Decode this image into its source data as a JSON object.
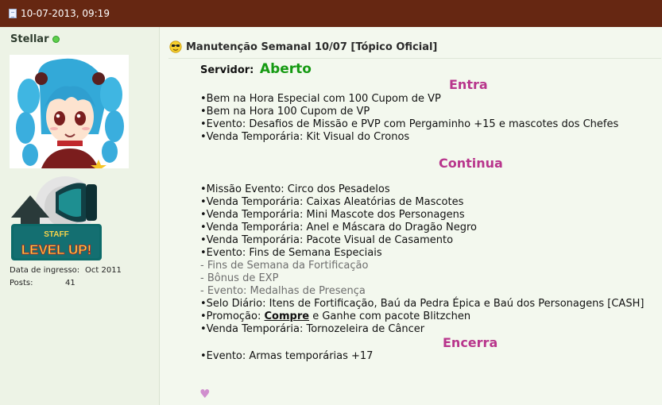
{
  "header": {
    "date": "10-07-2013, 09:19"
  },
  "user": {
    "name": "Stellar",
    "join_label": "Data de ingresso:",
    "join_value": "Oct 2011",
    "posts_label": "Posts:",
    "posts_value": "41",
    "badge_top": "STAFF",
    "badge_bottom": "LEVEL UP!"
  },
  "post": {
    "title": "Manutenção Semanal 10/07 [Tópico Oficial]",
    "server_label": "Servidor:",
    "server_status": "Aberto",
    "sections": {
      "entra": "Entra",
      "continua": "Continua",
      "encerra": "Encerra"
    },
    "entra_items": [
      "•Bem na Hora Especial com 100 Cupom de VP",
      "•Bem na Hora 100 Cupom de VP",
      "•Evento: Desafios de Missão e PVP com Pergaminho +15 e mascotes dos Chefes",
      "•Venda Temporária: Kit Visual do Cronos"
    ],
    "continua_items": [
      "•Missão Evento: Circo dos Pesadelos",
      "•Venda Temporária: Caixas Aleatórias de Mascotes",
      "•Venda Temporária: Mini Mascote dos Personagens",
      "•Venda Temporária: Anel e Máscara do Dragão Negro",
      "•Venda Temporária: Pacote Visual de Casamento",
      "•Evento: Fins de Semana Especiais"
    ],
    "sub_items": [
      " - Fins de Semana da Fortificação",
      " - Bônus de EXP",
      " - Evento: Medalhas de Presença"
    ],
    "continua_items_2": [
      "•Selo Diário: Itens de Fortificação, Baú da Pedra Épica e Baú dos Personagens [CASH]"
    ],
    "promo": {
      "prefix": "•Promoção: ",
      "link": "Compre",
      "suffix": " e Ganhe com pacote Blitzchen"
    },
    "continua_items_3": [
      "•Venda Temporária: Tornozeleira de Câncer"
    ],
    "encerra_items": [
      "•Evento: Armas temporárias +17"
    ],
    "heart": "♥"
  },
  "colors": {
    "header_bg": "#662712",
    "section_heading": "#b8358c",
    "server_open": "#159a12"
  }
}
